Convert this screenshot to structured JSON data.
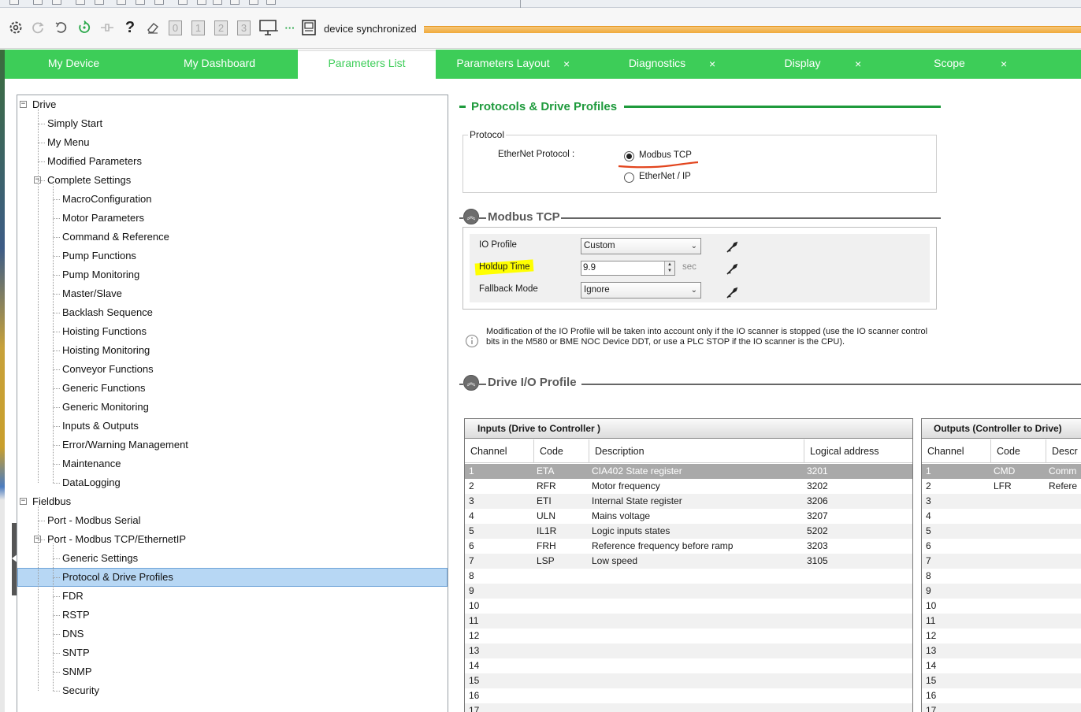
{
  "toolbar": {
    "status": "device synchronized",
    "icons": [
      "settings-icon",
      "refresh-icon",
      "undo-icon",
      "connect-icon",
      "disconnect-icon",
      "help-icon",
      "eraser-icon"
    ],
    "num_buttons": [
      "0",
      "1",
      "2",
      "3"
    ],
    "more": "···"
  },
  "tabs": [
    {
      "label": "My Device",
      "closable": false,
      "active": false
    },
    {
      "label": "My Dashboard",
      "closable": false,
      "active": false
    },
    {
      "label": "Parameters List",
      "closable": false,
      "active": true
    },
    {
      "label": "Parameters Layout",
      "closable": true,
      "active": false
    },
    {
      "label": "Diagnostics",
      "closable": true,
      "active": false
    },
    {
      "label": "Display",
      "closable": true,
      "active": false
    },
    {
      "label": "Scope",
      "closable": true,
      "active": false
    }
  ],
  "tab_close_glyph": "×",
  "tree": {
    "expanded_glyph": "−",
    "items": [
      {
        "label": "Drive",
        "level": 0,
        "expander": true
      },
      {
        "label": "Simply Start",
        "level": 1
      },
      {
        "label": "My Menu",
        "level": 1
      },
      {
        "label": "Modified Parameters",
        "level": 1
      },
      {
        "label": "Complete Settings",
        "level": 1,
        "expander": true
      },
      {
        "label": "MacroConfiguration",
        "level": 2
      },
      {
        "label": "Motor Parameters",
        "level": 2
      },
      {
        "label": "Command & Reference",
        "level": 2
      },
      {
        "label": "Pump Functions",
        "level": 2
      },
      {
        "label": "Pump Monitoring",
        "level": 2
      },
      {
        "label": "Master/Slave",
        "level": 2
      },
      {
        "label": "Backlash Sequence",
        "level": 2
      },
      {
        "label": "Hoisting Functions",
        "level": 2
      },
      {
        "label": "Hoisting Monitoring",
        "level": 2
      },
      {
        "label": "Conveyor Functions",
        "level": 2
      },
      {
        "label": "Generic Functions",
        "level": 2
      },
      {
        "label": "Generic Monitoring",
        "level": 2
      },
      {
        "label": "Inputs & Outputs",
        "level": 2
      },
      {
        "label": "Error/Warning Management",
        "level": 2
      },
      {
        "label": "Maintenance",
        "level": 2
      },
      {
        "label": "DataLogging",
        "level": 2
      },
      {
        "label": "Fieldbus",
        "level": 0,
        "expander": true
      },
      {
        "label": "Port - Modbus Serial",
        "level": 1
      },
      {
        "label": "Port - Modbus TCP/EthernetIP",
        "level": 1,
        "expander": true
      },
      {
        "label": "Generic Settings",
        "level": 2
      },
      {
        "label": "Protocol & Drive Profiles",
        "level": 2,
        "selected": true
      },
      {
        "label": "FDR",
        "level": 2
      },
      {
        "label": "RSTP",
        "level": 2
      },
      {
        "label": "DNS",
        "level": 2
      },
      {
        "label": "SNTP",
        "level": 2
      },
      {
        "label": "SNMP",
        "level": 2
      },
      {
        "label": "Security",
        "level": 2
      }
    ]
  },
  "main": {
    "section_title": "Protocols & Drive Profiles",
    "protocol_group": {
      "legend": "Protocol",
      "label": "EtherNet Protocol :",
      "options": [
        {
          "label": "Modbus TCP",
          "selected": true
        },
        {
          "label": "EtherNet / IP",
          "selected": false
        }
      ]
    },
    "modbus_section": {
      "title": "Modbus TCP",
      "collapse_glyph": "︽",
      "fields": {
        "io_profile": {
          "label": "IO Profile",
          "value": "Custom"
        },
        "holdup_time": {
          "label": "Holdup Time",
          "value": "9.9",
          "unit": "sec"
        },
        "fallback_mode": {
          "label": "Fallback Mode",
          "value": "Ignore"
        }
      },
      "info_text": "Modification of the IO Profile will be taken into account only if the IO scanner is stopped (use the IO scanner control bits in the M580 or BME NOC Device DDT, or use a PLC STOP if the IO scanner is the CPU)."
    },
    "drive_io_section": {
      "title": "Drive I/O Profile",
      "collapse_glyph": "︽"
    },
    "inputs_table": {
      "title": "Inputs (Drive to Controller )",
      "columns": [
        "Channel",
        "Code",
        "Description",
        "Logical address"
      ],
      "rows": [
        [
          "1",
          "ETA",
          "CIA402 State register",
          "3201"
        ],
        [
          "2",
          "RFR",
          "Motor frequency",
          "3202"
        ],
        [
          "3",
          "ETI",
          "Internal State register",
          "3206"
        ],
        [
          "4",
          "ULN",
          "Mains voltage",
          "3207"
        ],
        [
          "5",
          "IL1R",
          "Logic inputs states",
          "5202"
        ],
        [
          "6",
          "FRH",
          "Reference frequency before ramp",
          "3203"
        ],
        [
          "7",
          "LSP",
          "Low speed",
          "3105"
        ],
        [
          "8",
          "",
          "",
          ""
        ],
        [
          "9",
          "",
          "",
          ""
        ],
        [
          "10",
          "",
          "",
          ""
        ],
        [
          "11",
          "",
          "",
          ""
        ],
        [
          "12",
          "",
          "",
          ""
        ],
        [
          "13",
          "",
          "",
          ""
        ],
        [
          "14",
          "",
          "",
          ""
        ],
        [
          "15",
          "",
          "",
          ""
        ],
        [
          "16",
          "",
          "",
          ""
        ],
        [
          "17",
          "",
          "",
          ""
        ]
      ]
    },
    "outputs_table": {
      "title": "Outputs (Controller to Drive)",
      "columns": [
        "Channel",
        "Code",
        "Descr"
      ],
      "rows": [
        [
          "1",
          "CMD",
          "Comm"
        ],
        [
          "2",
          "LFR",
          "Refere"
        ],
        [
          "3",
          "",
          ""
        ],
        [
          "4",
          "",
          ""
        ],
        [
          "5",
          "",
          ""
        ],
        [
          "6",
          "",
          ""
        ],
        [
          "7",
          "",
          ""
        ],
        [
          "8",
          "",
          ""
        ],
        [
          "9",
          "",
          ""
        ],
        [
          "10",
          "",
          ""
        ],
        [
          "11",
          "",
          ""
        ],
        [
          "12",
          "",
          ""
        ],
        [
          "13",
          "",
          ""
        ],
        [
          "14",
          "",
          ""
        ],
        [
          "15",
          "",
          ""
        ],
        [
          "16",
          "",
          ""
        ],
        [
          "17",
          "",
          ""
        ]
      ]
    }
  },
  "colors": {
    "brand_green": "#3dcd58",
    "section_green": "#1e9a3c",
    "sync_orange": "#f0a93b",
    "annotation_red": "#e2451e",
    "annotation_yellow": "#ffff00",
    "selection_blue": "#b7d7f4"
  }
}
